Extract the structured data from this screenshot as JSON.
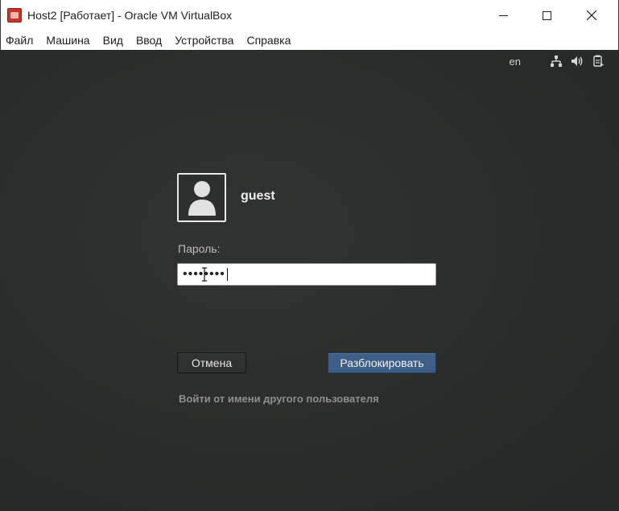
{
  "window": {
    "title": "Host2 [Работает] - Oracle VM VirtualBox",
    "app_icon": "virtualbox-icon",
    "controls": [
      "minimize",
      "maximize",
      "close"
    ]
  },
  "menu": {
    "items": [
      "Файл",
      "Машина",
      "Вид",
      "Ввод",
      "Устройства",
      "Справка"
    ]
  },
  "guest_panel": {
    "language": "en",
    "icons": [
      "network-icon",
      "volume-icon",
      "power-menu-icon"
    ]
  },
  "lock_screen": {
    "username": "guest",
    "password_label": "Пароль:",
    "password_value": "••••••••",
    "cancel_label": "Отмена",
    "unlock_label": "Разблокировать",
    "other_user_label": "Войти от имени другого пользователя"
  },
  "colors": {
    "background": "#2b2d2c",
    "unlock_button": "#3d5f87"
  }
}
